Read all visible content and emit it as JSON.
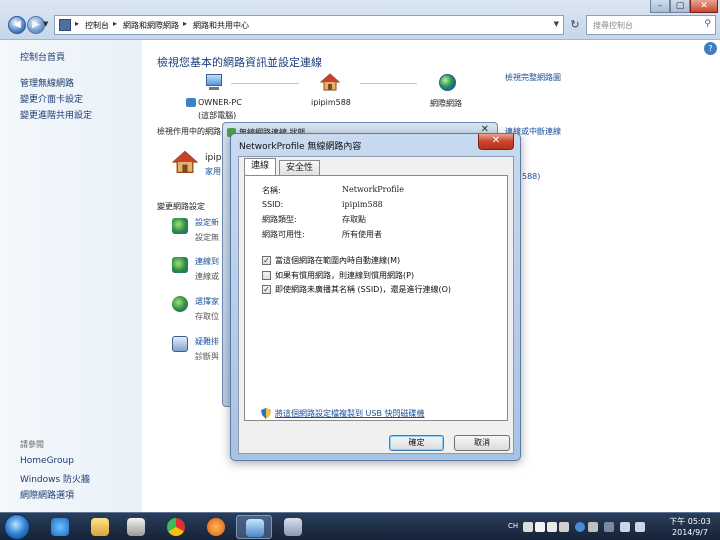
{
  "explorer": {
    "breadcrumb": [
      "控制台",
      "網路和網際網路",
      "網路和共用中心"
    ],
    "search_placeholder": "搜尋控制台"
  },
  "left_nav": {
    "home": "控制台首頁",
    "links": [
      "管理無線網路",
      "變更介面卡設定",
      "變更進階共用設定"
    ],
    "see_also": "請參閱",
    "see_also_links": [
      "HomeGroup",
      "Windows 防火牆",
      "網際網路選項"
    ]
  },
  "main": {
    "title": "檢視您基本的網路資訊並設定連線",
    "full_map_link": "檢視完整網路圖",
    "map": {
      "pc_name": "OWNER-PC",
      "pc_sub": "(這部電腦)",
      "network_name": "ipipim588",
      "internet": "網際網路"
    },
    "active_networks_label": "檢視作用中的網路",
    "connect_link": "連線或中斷連線",
    "network_short": "ipip",
    "network_type_short": "家用",
    "ssid_suffix": "588)",
    "change_settings_label": "變更網路設定",
    "tasks": [
      {
        "title": "設定新",
        "desc": "設定無"
      },
      {
        "title": "連線到",
        "desc": "連線或"
      },
      {
        "title": "選擇家",
        "desc": "存取位"
      },
      {
        "title": "疑難排",
        "desc": "診斷與"
      }
    ]
  },
  "status_window": {
    "title": "無線網路連線 狀態"
  },
  "dialog": {
    "title": "NetworkProfile 無線網路內容",
    "tabs": [
      "連線",
      "安全性"
    ],
    "fields": [
      {
        "key": "名稱:",
        "value": "NetworkProfile"
      },
      {
        "key": "SSID:",
        "value": "ipipim588"
      },
      {
        "key": "網路類型:",
        "value": "存取點"
      },
      {
        "key": "網路可用性:",
        "value": "所有使用者"
      }
    ],
    "options": [
      {
        "label": "當這個網路在範圍內時自動連線(M)",
        "checked": true
      },
      {
        "label": "如果有慣用網路，則連線到慣用網路(P)",
        "checked": false
      },
      {
        "label": "即使網路未廣播其名稱 (SSID)，還是進行連線(O)",
        "checked": true
      }
    ],
    "copy_link": "將這個網路設定檔複製到 USB 快閃磁碟機",
    "ok": "確定",
    "cancel": "取消"
  },
  "taskbar": {
    "lang": "CH",
    "time": "下午 05:03",
    "date": "2014/9/7"
  }
}
